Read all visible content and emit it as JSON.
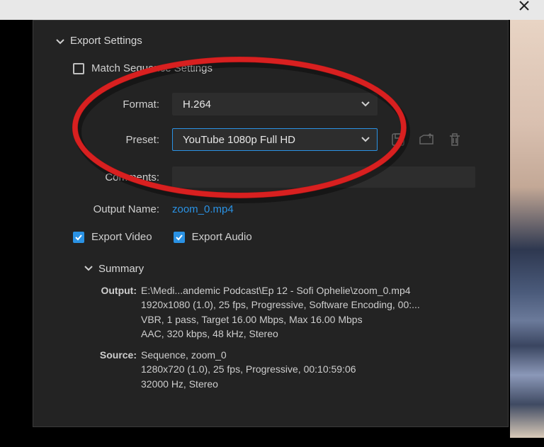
{
  "header": {
    "title": "Export Settings"
  },
  "match": {
    "label": "Match Sequence Settings",
    "checked": false
  },
  "format": {
    "label": "Format:",
    "value": "H.264"
  },
  "preset": {
    "label": "Preset:",
    "value": "YouTube 1080p Full HD"
  },
  "comments": {
    "label": "Comments:",
    "value": ""
  },
  "output": {
    "label": "Output Name:",
    "filename": "zoom_0.mp4"
  },
  "export_video": {
    "label": "Export Video",
    "checked": true
  },
  "export_audio": {
    "label": "Export Audio",
    "checked": true
  },
  "summary": {
    "heading": "Summary",
    "output_label": "Output:",
    "output_lines": [
      "E:\\Medi...andemic Podcast\\Ep 12 - Sofi Ophelie\\zoom_0.mp4",
      "1920x1080 (1.0), 25 fps, Progressive, Software Encoding, 00:...",
      "VBR, 1 pass, Target 16.00 Mbps, Max 16.00 Mbps",
      "AAC, 320 kbps, 48 kHz, Stereo"
    ],
    "source_label": "Source:",
    "source_lines": [
      "Sequence, zoom_0",
      "1280x720 (1.0), 25 fps, Progressive, 00:10:59:06",
      "32000 Hz, Stereo"
    ]
  }
}
